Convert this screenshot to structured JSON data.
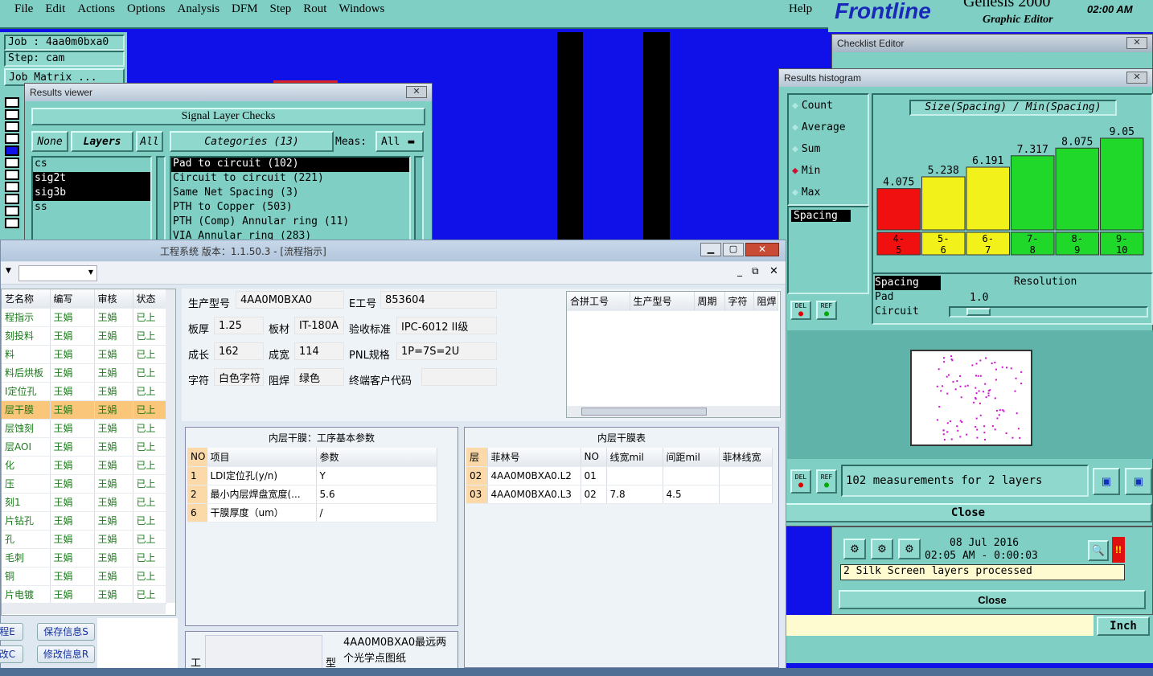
{
  "menubar": {
    "items": [
      "File",
      "Edit",
      "Actions",
      "Options",
      "Analysis",
      "DFM",
      "Step",
      "Rout",
      "Windows"
    ],
    "help": "Help"
  },
  "brand": {
    "logo": "Frontline",
    "product": "Genesis 2000",
    "subtitle": "Graphic Editor",
    "time": "02:00 AM"
  },
  "job": {
    "job_line": "Job : 4aa0m0bxa0",
    "step_line": "Step: cam",
    "matrix_button": "Job Matrix ..."
  },
  "results_viewer": {
    "title": "Results viewer",
    "header": "Signal Layer Checks",
    "none_button": "None",
    "layers_button": "Layers",
    "all_button": "All",
    "categories_button": "Categories (13)",
    "meas_label": "Meas:",
    "meas_value": "All",
    "layers": [
      "cs",
      "sig2t",
      "sig3b",
      "ss"
    ],
    "categories": [
      "Pad to circuit (102)",
      "Circuit to circuit (221)",
      "Same Net Spacing (3)",
      "PTH to Copper (503)",
      "PTH (Comp) Annular ring (11)",
      "VIA Annular ring (283)"
    ]
  },
  "checklist": {
    "title": "Checklist Editor"
  },
  "histogram": {
    "title": "Results histogram",
    "modes": [
      "Count",
      "Average",
      "Sum",
      "Min",
      "Max"
    ],
    "selected_mode": "Min",
    "list_item": "Spacing",
    "chart_title": "Size(Spacing) / Min(Spacing)",
    "del_label": "DEL",
    "ref_label": "REF",
    "resolution_label": "Resolution",
    "resolution_value": "1.0",
    "types": [
      "Spacing",
      "Pad",
      "Circuit"
    ],
    "summary": "102 measurements for 2 layers",
    "close": "Close"
  },
  "chart_data": {
    "type": "bar",
    "title": "Size(Spacing) / Min(Spacing)",
    "categories": [
      "4-5",
      "5-6",
      "6-7",
      "7-8",
      "8-9",
      "9-10"
    ],
    "values": [
      4.075,
      5.238,
      6.191,
      7.317,
      8.075,
      9.05
    ],
    "value_labels": [
      "4.075",
      "5.238",
      "6.191",
      "7.317",
      "8.075",
      "9.05"
    ],
    "bin_top": [
      "4-",
      "5-",
      "6-",
      "7-",
      "8-",
      "9-"
    ],
    "bin_bottom": [
      "5",
      "6",
      "7",
      "8",
      "9",
      "10"
    ],
    "colors": [
      "#f01010",
      "#f2f21a",
      "#f2f21a",
      "#20d82a",
      "#20d82a",
      "#20d82a"
    ],
    "ylim": [
      0,
      10
    ]
  },
  "status": {
    "date": "08 Jul 2016",
    "time": "02:05 AM - 0:00:03",
    "message": "2 Silk Screen layers processed",
    "close": "Close",
    "units": "Inch",
    "alert": "!!"
  },
  "erp": {
    "title": "工程系统  版本：1.1.50.3 - [流程指示]",
    "left_headers": [
      "艺名称",
      "编写",
      "审核",
      "状态"
    ],
    "left_rows": [
      [
        "程指示",
        "王娟",
        "王娟",
        "已上"
      ],
      [
        "刻投料",
        "王娟",
        "王娟",
        "已上"
      ],
      [
        "料",
        "王娟",
        "王娟",
        "已上"
      ],
      [
        "料后烘板",
        "王娟",
        "王娟",
        "已上"
      ],
      [
        "I定位孔",
        "王娟",
        "王娟",
        "已上"
      ],
      [
        "层干膜",
        "王娟",
        "王娟",
        "已上"
      ],
      [
        "层蚀刻",
        "王娟",
        "王娟",
        "已上"
      ],
      [
        "层AOI",
        "王娟",
        "王娟",
        "已上"
      ],
      [
        "化",
        "王娟",
        "王娟",
        "已上"
      ],
      [
        "压",
        "王娟",
        "王娟",
        "已上"
      ],
      [
        "刻1",
        "王娟",
        "王娟",
        "已上"
      ],
      [
        "片钻孔",
        "王娟",
        "王娟",
        "已上"
      ],
      [
        "孔",
        "王娟",
        "王娟",
        "已上"
      ],
      [
        "毛刺",
        "王娟",
        "王娟",
        "已上"
      ],
      [
        "铜",
        "王娟",
        "王娟",
        "已上"
      ],
      [
        "片电镀",
        "王娟",
        "王娟",
        "已上"
      ]
    ],
    "selected_row": 5,
    "buttons": [
      "程E",
      "保存信息S",
      "改C",
      "修改信息R"
    ],
    "form": {
      "model_label": "生产型号",
      "model_value": "4AA0M0BXA0",
      "eno_label": "E工号",
      "eno_value": "853604",
      "thick_label": "板厚",
      "thick_value": "1.25",
      "mat_label": "板材",
      "mat_value": "IT-180A",
      "std_label": "验收标准",
      "std_value": "IPC-6012 II级",
      "len_label": "成长",
      "len_value": "162",
      "wid_label": "成宽",
      "wid_value": "114",
      "pnl_label": "PNL规格",
      "pnl_value": "1P=7S=2U",
      "char_label": "字符",
      "char_value": "白色字符",
      "mask_label": "阻焊",
      "mask_value": "绿色",
      "cust_label": "终端客户代码",
      "cust_value": ""
    },
    "panel_headers": [
      "合拼工号",
      "生产型号",
      "周期",
      "字符",
      "阻焊"
    ],
    "params": {
      "title": "内层干膜：工序基本参数",
      "headers": [
        "NO",
        "项目",
        "参数"
      ],
      "rows": [
        [
          "1",
          "LDI定位孔(y/n)",
          "Y"
        ],
        [
          "2",
          "最小内层焊盘宽度(...",
          "5.6"
        ],
        [
          "6",
          "干膜厚度（um）",
          "/"
        ]
      ]
    },
    "films": {
      "title": "内层干膜表",
      "headers": [
        "层",
        "菲林号",
        "NO",
        "线宽mil",
        "间距mil",
        "菲林线宽"
      ],
      "rows": [
        [
          "02",
          "4AA0M0BXA0.L2",
          "01",
          "",
          "",
          ""
        ],
        [
          "03",
          "4AA0M0BXA0.L3",
          "02",
          "7.8",
          "4.5",
          ""
        ]
      ]
    },
    "bottom_label1": "工",
    "bottom_label2": "型",
    "note": "4AA0M0BXA0最远两个光学点图纸"
  }
}
